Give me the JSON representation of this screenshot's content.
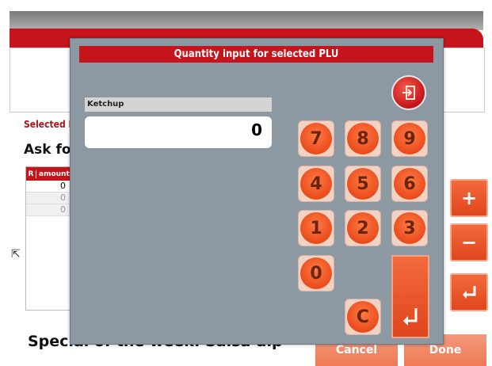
{
  "background": {
    "selected_label": "Selected N",
    "ask_label": "Ask for :",
    "table": {
      "col_r": "R",
      "col_amount": "amount",
      "rows": [
        "0",
        "0",
        "0"
      ]
    },
    "special_text": "Special of the week: Salsa dip",
    "side_buttons": {
      "plus": "+",
      "minus": "−"
    },
    "cancel_label": "Cancel",
    "done_label": "Done"
  },
  "dialog": {
    "title": "Quantity input for selected PLU",
    "item_name": "Ketchup",
    "quantity_value": "0",
    "keys": [
      "7",
      "8",
      "9",
      "4",
      "5",
      "6",
      "1",
      "2",
      "3",
      "0"
    ],
    "clear_label": "C"
  },
  "colors": {
    "accent_red": "#c5141c",
    "key_orange": "#ea4c1c",
    "dialog_bg": "#8c98a2"
  }
}
